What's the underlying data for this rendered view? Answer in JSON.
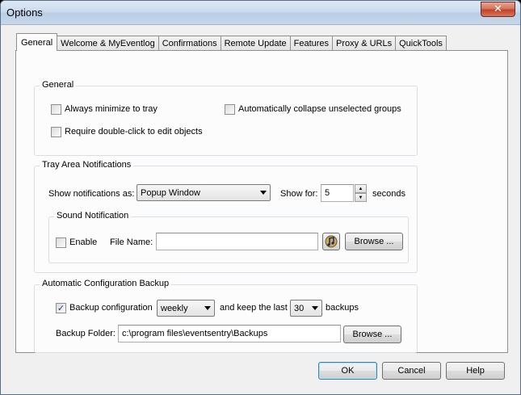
{
  "window": {
    "title": "Options",
    "close_glyph": "✕"
  },
  "tabs": [
    {
      "label": "General",
      "active": true
    },
    {
      "label": "Welcome & MyEventlog"
    },
    {
      "label": "Confirmations"
    },
    {
      "label": "Remote Update"
    },
    {
      "label": "Features"
    },
    {
      "label": "Proxy & URLs"
    },
    {
      "label": "QuickTools"
    }
  ],
  "general": {
    "group_label": "General",
    "always_minimize": {
      "label": "Always minimize to tray",
      "checked": false
    },
    "collapse_groups": {
      "label": "Automatically collapse unselected groups",
      "checked": false
    },
    "double_click": {
      "label": "Require double-click to edit objects",
      "checked": false
    }
  },
  "tray": {
    "group_label": "Tray Area Notifications",
    "show_as_label": "Show notifications as:",
    "show_as_value": "Popup Window",
    "show_for_label": "Show for:",
    "show_for_value": "5",
    "seconds_label": "seconds",
    "sound": {
      "group_label": "Sound Notification",
      "enable_label": "Enable",
      "enable_checked": false,
      "file_name_label": "File Name:",
      "file_name_value": "",
      "browse_label": "Browse ..."
    }
  },
  "backup": {
    "group_label": "Automatic Configuration Backup",
    "backup_label": "Backup configuration",
    "backup_checked": true,
    "frequency_value": "weekly",
    "keep_label": "and keep the last",
    "count_value": "30",
    "backups_label": "backups",
    "folder_label": "Backup Folder:",
    "folder_value": "c:\\program files\\eventsentry\\Backups",
    "browse_label": "Browse ..."
  },
  "footer": {
    "ok": "OK",
    "cancel": "Cancel",
    "help": "Help"
  },
  "colors": {
    "accent": "#3c7fb1",
    "close": "#c1432a"
  }
}
